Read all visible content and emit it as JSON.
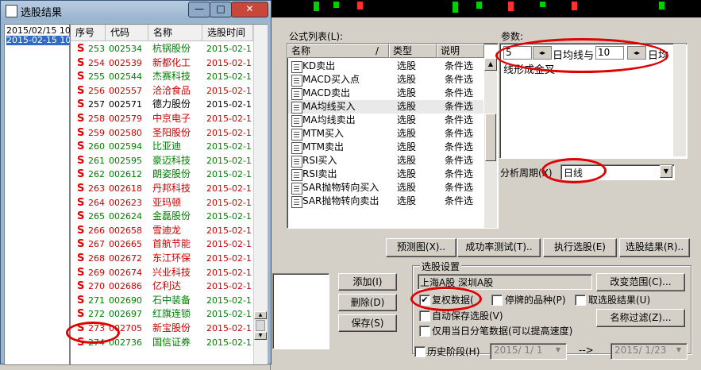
{
  "background": {
    "accent_up": "#ff3030",
    "accent_down": "#00d000"
  },
  "result_window": {
    "title": "选股结果",
    "window_buttons": [
      "—",
      "□",
      "✕"
    ],
    "dates": [
      "2015/02/15 10",
      "2015-02-15 10"
    ],
    "columns": [
      "序号",
      "代码",
      "名称",
      "选股时间"
    ],
    "rows": [
      {
        "s": "S",
        "no": "253",
        "code": "002534",
        "name": "杭锅股份",
        "time": "2015-02-1",
        "color": "#008000"
      },
      {
        "s": "S",
        "no": "254",
        "code": "002539",
        "name": "新都化工",
        "time": "2015-02-1",
        "color": "#d00000"
      },
      {
        "s": "S",
        "no": "255",
        "code": "002544",
        "name": "杰赛科技",
        "time": "2015-02-1",
        "color": "#008000"
      },
      {
        "s": "S",
        "no": "256",
        "code": "002557",
        "name": "洽洽食品",
        "time": "2015-02-1",
        "color": "#d00000"
      },
      {
        "s": "S",
        "no": "257",
        "code": "002571",
        "name": "德力股份",
        "time": "2015-02-1",
        "color": "#000000"
      },
      {
        "s": "S",
        "no": "258",
        "code": "002579",
        "name": "中京电子",
        "time": "2015-02-1",
        "color": "#d00000"
      },
      {
        "s": "S",
        "no": "259",
        "code": "002580",
        "name": "圣阳股份",
        "time": "2015-02-1",
        "color": "#d00000"
      },
      {
        "s": "S",
        "no": "260",
        "code": "002594",
        "name": "比亚迪",
        "time": "2015-02-1",
        "color": "#008000"
      },
      {
        "s": "S",
        "no": "261",
        "code": "002595",
        "name": "豪迈科技",
        "time": "2015-02-1",
        "color": "#008000"
      },
      {
        "s": "S",
        "no": "262",
        "code": "002612",
        "name": "朗姿股份",
        "time": "2015-02-1",
        "color": "#008000"
      },
      {
        "s": "S",
        "no": "263",
        "code": "002618",
        "name": "丹邦科技",
        "time": "2015-02-1",
        "color": "#d00000"
      },
      {
        "s": "S",
        "no": "264",
        "code": "002623",
        "name": "亚玛顿",
        "time": "2015-02-1",
        "color": "#d00000"
      },
      {
        "s": "S",
        "no": "265",
        "code": "002624",
        "name": "金磊股份",
        "time": "2015-02-1",
        "color": "#008000"
      },
      {
        "s": "S",
        "no": "266",
        "code": "002658",
        "name": "雪迪龙",
        "time": "2015-02-1",
        "color": "#d00000"
      },
      {
        "s": "S",
        "no": "267",
        "code": "002665",
        "name": "首航节能",
        "time": "2015-02-1",
        "color": "#d00000"
      },
      {
        "s": "S",
        "no": "268",
        "code": "002672",
        "name": "东江环保",
        "time": "2015-02-1",
        "color": "#d00000"
      },
      {
        "s": "S",
        "no": "269",
        "code": "002674",
        "name": "兴业科技",
        "time": "2015-02-1",
        "color": "#d00000"
      },
      {
        "s": "S",
        "no": "270",
        "code": "002686",
        "name": "亿利达",
        "time": "2015-02-1",
        "color": "#d00000"
      },
      {
        "s": "S",
        "no": "271",
        "code": "002690",
        "name": "石中装备",
        "time": "2015-02-1",
        "color": "#008000"
      },
      {
        "s": "S",
        "no": "272",
        "code": "002697",
        "name": "红旗连锁",
        "time": "2015-02-1",
        "color": "#008000"
      },
      {
        "s": "S",
        "no": "273",
        "code": "002705",
        "name": "新宝股份",
        "time": "2015-02-1",
        "color": "#d00000"
      },
      {
        "s": "S",
        "no": "274",
        "code": "002736",
        "name": "国信证券",
        "time": "2015-02-1",
        "color": "#008000"
      }
    ]
  },
  "formula_panel": {
    "label": "公式列表(L):",
    "columns": [
      "名称",
      "类型",
      "说明"
    ],
    "sort_slash": "/",
    "rows": [
      {
        "name": "KD卖出",
        "type": "选股",
        "desc": "条件选"
      },
      {
        "name": "MACD买入点",
        "type": "选股",
        "desc": "条件选"
      },
      {
        "name": "MACD卖出",
        "type": "选股",
        "desc": "条件选"
      },
      {
        "name": "MA均线买入",
        "type": "选股",
        "desc": "条件选"
      },
      {
        "name": "MA均线卖出",
        "type": "选股",
        "desc": "条件选"
      },
      {
        "name": "MTM买入",
        "type": "选股",
        "desc": "条件选"
      },
      {
        "name": "MTM卖出",
        "type": "选股",
        "desc": "条件选"
      },
      {
        "name": "RSI买入",
        "type": "选股",
        "desc": "条件选"
      },
      {
        "name": "RSI卖出",
        "type": "选股",
        "desc": "条件选"
      },
      {
        "name": "SAR抛物转向买入",
        "type": "选股",
        "desc": "条件选"
      },
      {
        "name": "SAR抛物转向卖出",
        "type": "选股",
        "desc": "条件选"
      }
    ]
  },
  "params": {
    "label": "参数:",
    "value1": "5",
    "text1": "日均线与",
    "value2": "10",
    "text2": "日均",
    "line2": "线形成金叉"
  },
  "period": {
    "label": "分析周期(X)",
    "selected": "日线"
  },
  "buttons": {
    "preview": "预测图(X)..",
    "success": "成功率测试(T)..",
    "execute": "执行选股(E)",
    "result": "选股结果(R).."
  },
  "settings": {
    "group_label": "选股设置",
    "range_text": "上海A股  深圳A股",
    "change_range": "改变范围(C)...",
    "opt_fq": "复权数据(",
    "opt_suspended": "停牌的品种(P)",
    "opt_result": "取选股结果(U)",
    "opt_autosave": "自动保存选股(V)",
    "opt_minute": "仅用当日分笔数据(可以提高速度)",
    "name_filter": "名称过滤(Z)...",
    "history_label": "历史阶段(H)",
    "date_from": "2015/ 1/ 1",
    "arrow": "-->",
    "date_to": "2015/ 1/23"
  },
  "side_buttons": {
    "add": "添加(I)",
    "delete": "删除(D)",
    "save": "保存(S)"
  }
}
